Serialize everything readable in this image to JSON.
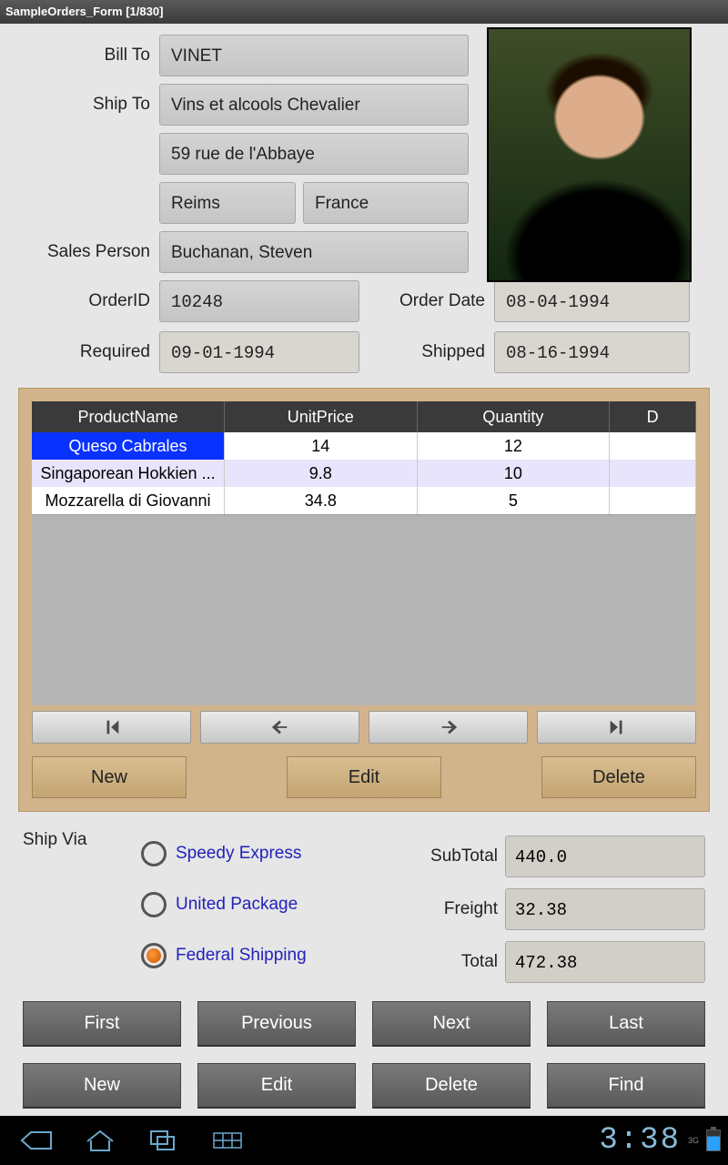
{
  "title": "SampleOrders_Form [1/830]",
  "labels": {
    "billTo": "Bill To",
    "shipTo": "Ship To",
    "salesPerson": "Sales Person",
    "orderId": "OrderID",
    "orderDate": "Order Date",
    "required": "Required",
    "shipped": "Shipped",
    "shipVia": "Ship Via",
    "subTotal": "SubTotal",
    "freight": "Freight",
    "total": "Total"
  },
  "form": {
    "billTo": "VINET",
    "shipTo": "Vins et alcools Chevalier",
    "address": "59 rue de l'Abbaye",
    "city": "Reims",
    "country": "France",
    "salesPerson": "Buchanan, Steven",
    "orderId": "10248",
    "orderDate": "08-04-1994",
    "required": "09-01-1994",
    "shipped": "08-16-1994"
  },
  "table": {
    "headers": [
      "ProductName",
      "UnitPrice",
      "Quantity",
      "D"
    ],
    "rows": [
      {
        "name": "Queso Cabrales",
        "price": "14",
        "qty": "12",
        "selected": true
      },
      {
        "name": "Singaporean Hokkien ...",
        "price": "9.8",
        "qty": "10",
        "alt": true
      },
      {
        "name": "Mozzarella di Giovanni",
        "price": "34.8",
        "qty": "5"
      }
    ]
  },
  "tanButtons": {
    "new": "New",
    "edit": "Edit",
    "delete": "Delete"
  },
  "shipOptions": [
    {
      "label": "Speedy Express",
      "checked": false
    },
    {
      "label": "United Package",
      "checked": false
    },
    {
      "label": "Federal Shipping",
      "checked": true
    }
  ],
  "totals": {
    "subTotal": "440.0",
    "freight": "32.38",
    "total": "472.38"
  },
  "navButtons": {
    "first": "First",
    "previous": "Previous",
    "next": "Next",
    "last": "Last",
    "new": "New",
    "edit": "Edit",
    "delete": "Delete",
    "find": "Find"
  },
  "androidBar": {
    "time": "3:38",
    "signal": "3G"
  }
}
